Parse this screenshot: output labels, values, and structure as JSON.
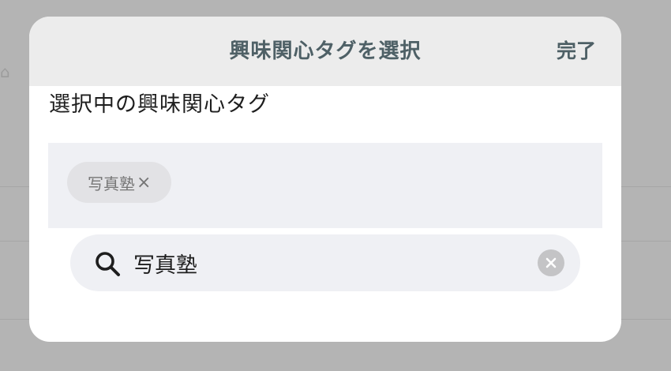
{
  "header": {
    "title": "興味関心タグを選択",
    "done_label": "完了"
  },
  "selected_section": {
    "label": "選択中の興味関心タグ",
    "tags": [
      {
        "label": "写真塾",
        "remove_symbol": "×"
      }
    ]
  },
  "search": {
    "value": "写真塾",
    "icon": "search-icon",
    "clear_icon": "clear-icon"
  },
  "colors": {
    "header_bg": "#ececec",
    "header_text": "#4e6066",
    "tag_area_bg": "#eff0f4",
    "chip_bg": "#e2e2e5",
    "overlay": "#b4b4b4"
  }
}
